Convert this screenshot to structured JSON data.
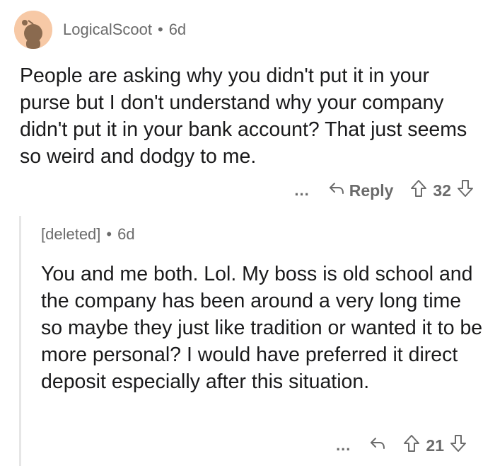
{
  "top_comment": {
    "username": "LogicalScoot",
    "separator": "•",
    "age": "6d",
    "body": "People are asking why you didn't put it in your purse but I don't understand why your company didn't put it in your bank account? That just seems so weird and dodgy to me.",
    "more_label": "...",
    "reply_label": "Reply",
    "score": "32"
  },
  "reply_comment": {
    "username": "[deleted]",
    "separator": "•",
    "age": "6d",
    "body": "You and me both. Lol. My boss is old school and the company has been around a very long time so maybe they just like tradition or wanted it to be more personal? I would have preferred it direct deposit especially after this situation.",
    "more_label": "...",
    "score": "21"
  },
  "colors": {
    "avatar_bg": "#f7c9a6",
    "meta_text": "#6b6b6b",
    "body_text": "#1a1a1b",
    "thread_line": "#e6e6e6"
  },
  "icons": {
    "avatar": "snoo-avatar-icon",
    "reply": "reply-arrow-icon",
    "upvote": "upvote-arrow-icon",
    "downvote": "downvote-arrow-icon"
  }
}
